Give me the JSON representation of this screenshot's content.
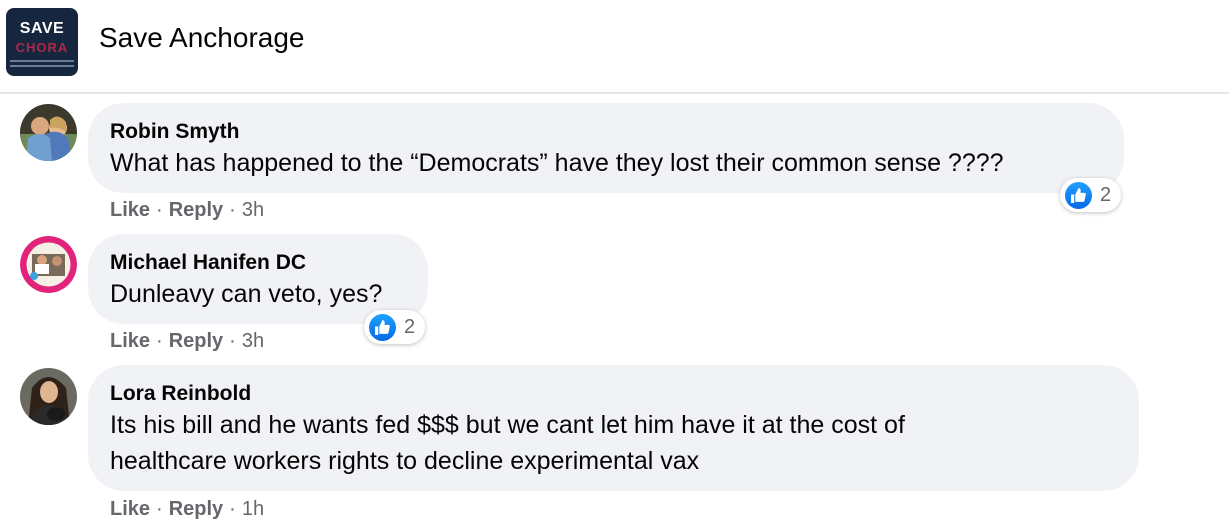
{
  "group": {
    "name": "Save Anchorage",
    "logo_text": "SAVE",
    "logo_sub": "CHORA"
  },
  "colors": {
    "bubble": "#f0f2f5",
    "like_blue": "#1877f2",
    "meta_gray": "#65676b"
  },
  "comments": [
    {
      "author": "Robin Smyth",
      "text": "What has happened to the “Democrats” have they lost their common sense ????",
      "like_label": "Like",
      "reply_label": "Reply",
      "time": "3h",
      "reaction_count": "2"
    },
    {
      "author": "Michael Hanifen DC",
      "text": "Dunleavy can veto, yes?",
      "like_label": "Like",
      "reply_label": "Reply",
      "time": "3h",
      "reaction_count": "2"
    },
    {
      "author": "Lora Reinbold",
      "text_line1": "Its his bill and he wants fed $$$ but we cant let him have it at the cost of",
      "text_line2": "healthcare workers rights to decline experimental vax",
      "like_label": "Like",
      "reply_label": "Reply",
      "time": "1h"
    }
  ]
}
